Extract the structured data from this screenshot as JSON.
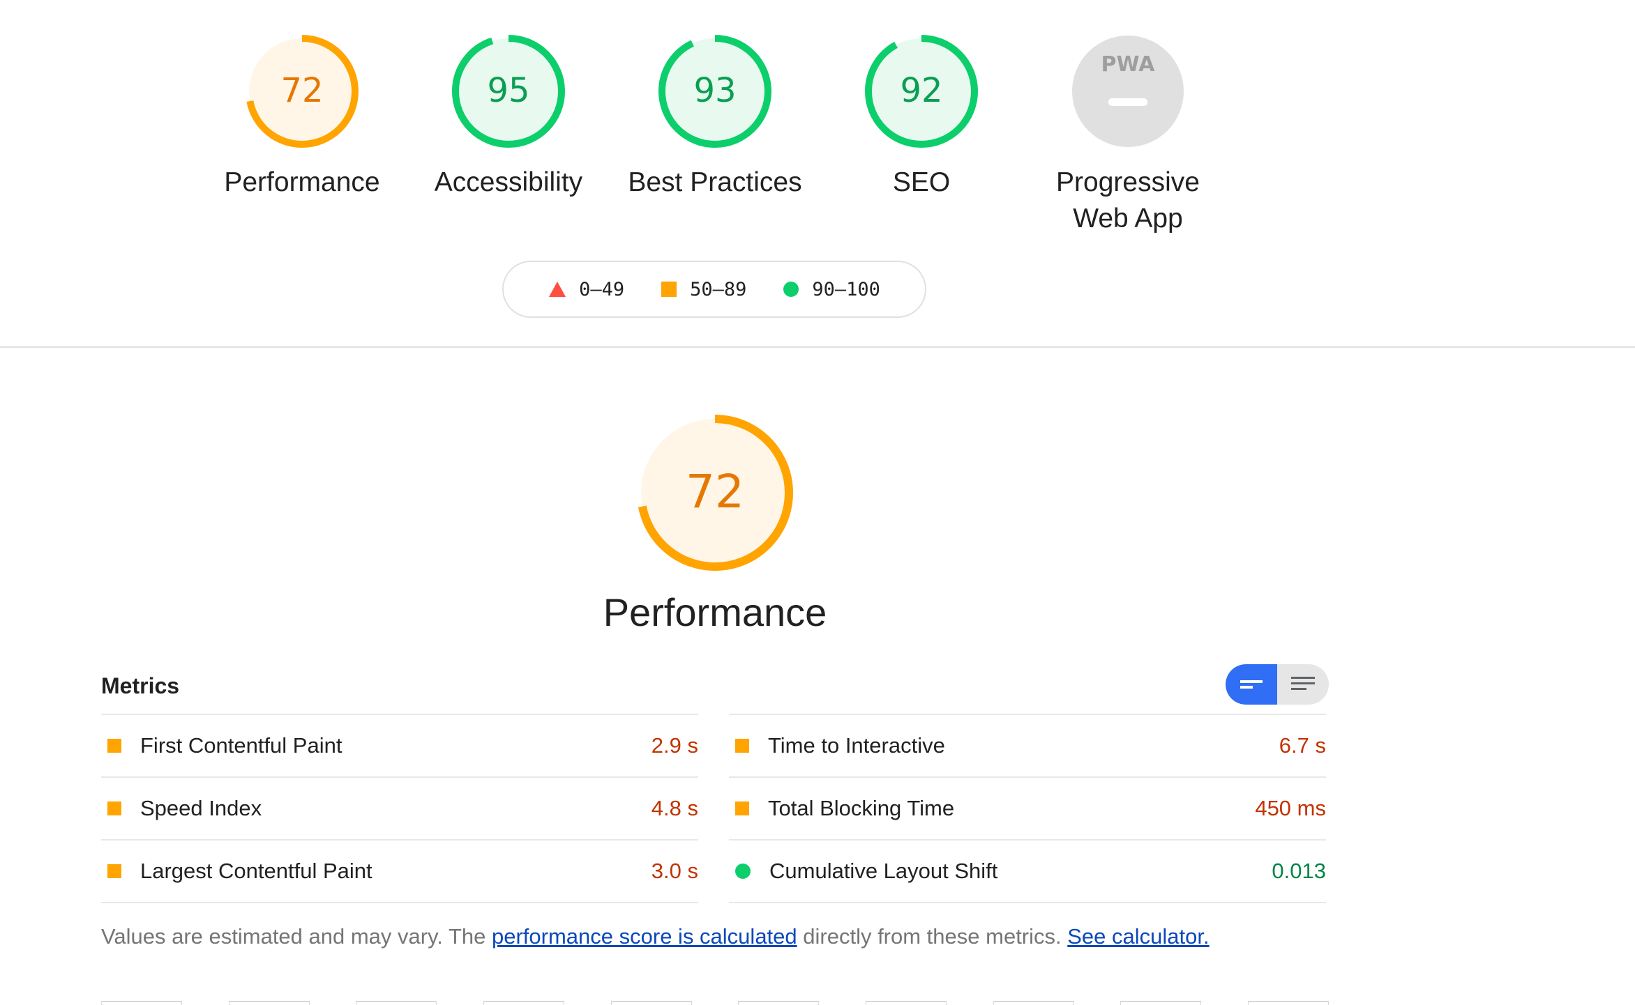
{
  "categories": [
    {
      "score": "72",
      "value": 0.72,
      "label": "Performance",
      "color": "#ffa400",
      "fill": "#fff6e8"
    },
    {
      "score": "95",
      "value": 0.95,
      "label": "Accessibility",
      "color": "#0cce6b",
      "fill": "#e8f9f0"
    },
    {
      "score": "93",
      "value": 0.93,
      "label": "Best Practices",
      "color": "#0cce6b",
      "fill": "#e8f9f0"
    },
    {
      "score": "92",
      "value": 0.92,
      "label": "SEO",
      "color": "#0cce6b",
      "fill": "#e8f9f0"
    }
  ],
  "pwa": {
    "badge": "PWA",
    "label_line1": "Progressive",
    "label_line2": "Web App"
  },
  "legend": [
    {
      "range": "0–49",
      "shape": "triangle",
      "color": "#ff4e42"
    },
    {
      "range": "50–89",
      "shape": "square",
      "color": "#ffa400"
    },
    {
      "range": "90–100",
      "shape": "circle",
      "color": "#0cce6b"
    }
  ],
  "performance": {
    "score": "72",
    "value": 0.72,
    "title": "Performance"
  },
  "metrics": {
    "title": "Metrics",
    "left": [
      {
        "name": "First Contentful Paint",
        "value": "2.9 s"
      },
      {
        "name": "Speed Index",
        "value": "4.8 s"
      },
      {
        "name": "Largest Contentful Paint",
        "value": "3.0 s"
      }
    ],
    "right": [
      {
        "name": "Time to Interactive",
        "value": "6.7 s"
      },
      {
        "name": "Total Blocking Time",
        "value": "450 ms"
      },
      {
        "name": "Cumulative Layout Shift",
        "value": "0.013"
      }
    ]
  },
  "footnote": {
    "prefix": "Values are estimated and may vary. The ",
    "link1": "performance score is calculated",
    "middle": " directly from these metrics. ",
    "link2": "See calculator."
  }
}
